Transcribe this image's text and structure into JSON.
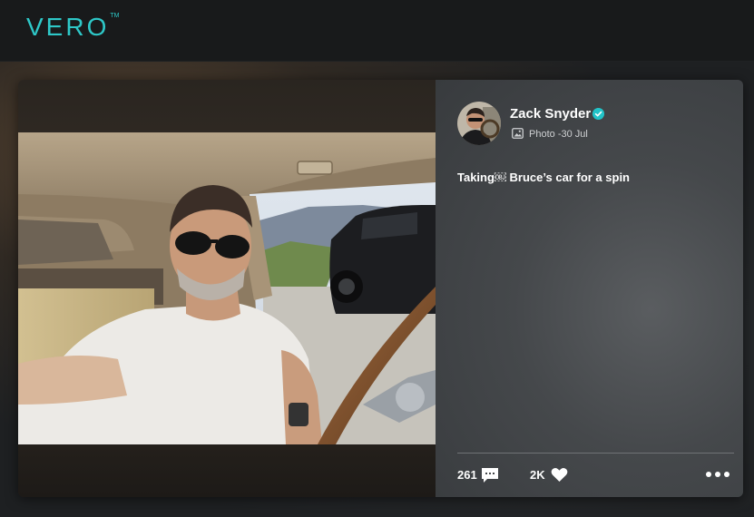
{
  "brand": {
    "name": "VERO",
    "trademark": "TM"
  },
  "post": {
    "author": "Zack Snyder",
    "verified": true,
    "type_label": "Photo",
    "date": "-30 Jul",
    "caption": "Taking￼ Bruce’s car for a spin",
    "comments": "261",
    "likes": "2K"
  },
  "icons": {
    "logo": "vero-logo",
    "verified": "verified-badge-icon",
    "photo": "photo-icon",
    "comment": "comment-icon",
    "like": "heart-icon",
    "more": "more-icon"
  },
  "colors": {
    "accent": "#22c3c8",
    "topbar": "#181a1b",
    "panel": "#45484b"
  }
}
